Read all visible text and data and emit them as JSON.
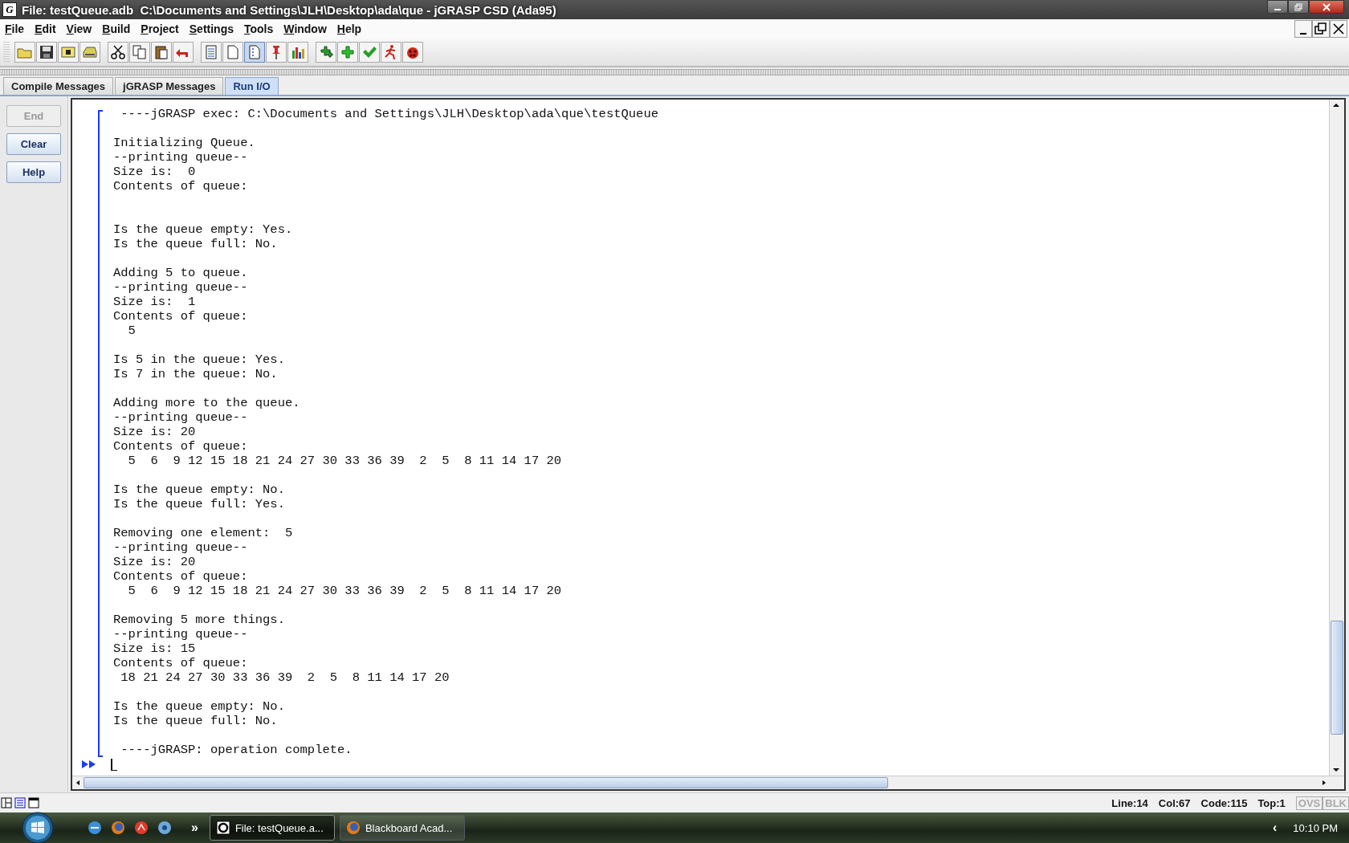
{
  "window": {
    "title": "File: testQueue.adb  C:\\Documents and Settings\\JLH\\Desktop\\ada\\que - jGRASP CSD (Ada95)",
    "app_letter": "G"
  },
  "menu": [
    "File",
    "Edit",
    "View",
    "Build",
    "Project",
    "Settings",
    "Tools",
    "Window",
    "Help"
  ],
  "toolbar": [
    [
      {
        "selected": false
      },
      {
        "selected": false
      },
      {
        "selected": false
      },
      {
        "selected": false
      }
    ],
    [
      {
        "selected": false
      },
      {
        "selected": false
      },
      {
        "selected": false
      },
      {
        "selected": false
      }
    ],
    [
      {
        "selected": false
      },
      {
        "selected": false
      },
      {
        "selected": true
      },
      {
        "selected": false
      },
      {
        "selected": false
      }
    ],
    [
      {
        "selected": false
      },
      {
        "selected": false
      },
      {
        "selected": false
      },
      {
        "selected": false
      },
      {
        "selected": false
      }
    ]
  ],
  "tabs": [
    {
      "label": "Compile Messages",
      "selected": false
    },
    {
      "label": "jGRASP Messages",
      "selected": false
    },
    {
      "label": "Run I/O",
      "selected": true
    }
  ],
  "side_buttons": [
    {
      "label": "End",
      "disabled": true
    },
    {
      "label": "Clear",
      "disabled": false
    },
    {
      "label": "Help",
      "disabled": false
    }
  ],
  "output": {
    "header": " ----jGRASP exec: C:\\Documents and Settings\\JLH\\Desktop\\ada\\que\\testQueue",
    "blocks": [
      {
        "lines": [
          "Initializing Queue.",
          "--printing queue--",
          "Size is:  0",
          "Contents of queue:"
        ],
        "contents_empty": true
      },
      {
        "lines": [
          "Is the queue empty: Yes.",
          "Is the queue full: No."
        ],
        "contents_empty": false
      },
      {
        "lines": [
          "Adding 5 to queue.",
          "--printing queue--",
          "Size is:  1",
          "Contents of queue:",
          "  5"
        ],
        "contents_empty": false
      },
      {
        "lines": [
          "Is 5 in the queue: Yes.",
          "Is 7 in the queue: No."
        ],
        "contents_empty": false
      },
      {
        "lines": [
          "Adding more to the queue.",
          "--printing queue--",
          "Size is: 20",
          "Contents of queue:",
          "  5  6  9 12 15 18 21 24 27 30 33 36 39  2  5  8 11 14 17 20"
        ],
        "contents_empty": false
      },
      {
        "lines": [
          "Is the queue empty: No.",
          "Is the queue full: Yes."
        ],
        "contents_empty": false
      },
      {
        "lines": [
          "Removing one element:  5",
          "--printing queue--",
          "Size is: 20",
          "Contents of queue:",
          "  5  6  9 12 15 18 21 24 27 30 33 36 39  2  5  8 11 14 17 20"
        ],
        "contents_empty": false
      },
      {
        "lines": [
          "Removing 5 more things.",
          "--printing queue--",
          "Size is: 15",
          "Contents of queue:",
          " 18 21 24 27 30 33 36 39  2  5  8 11 14 17 20"
        ],
        "contents_empty": false
      },
      {
        "lines": [
          "Is the queue empty: No.",
          "Is the queue full: No."
        ],
        "contents_empty": false
      }
    ],
    "footer": " ----jGRASP: operation complete."
  },
  "status_bar": {
    "items": [
      "Line:14",
      "Col:67",
      "Code:115",
      "Top:1"
    ],
    "modes": [
      {
        "label": "OVS",
        "on": false
      },
      {
        "label": "BLK",
        "on": false
      }
    ]
  },
  "taskbar": {
    "more": "»",
    "tasks": [
      {
        "label": "File: testQueue.a...",
        "selected": true
      },
      {
        "label": "Blackboard Acad...",
        "selected": false
      }
    ],
    "tray_arrow": "‹",
    "clock": "10:10 PM"
  }
}
